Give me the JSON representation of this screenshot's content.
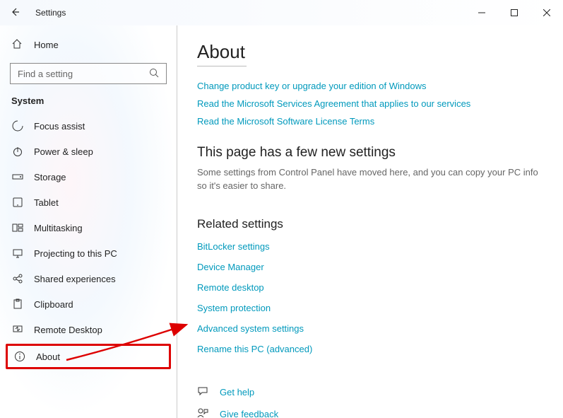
{
  "window": {
    "title": "Settings"
  },
  "sidebar": {
    "home_label": "Home",
    "search_placeholder": "Find a setting",
    "section_label": "System",
    "items": [
      {
        "label": "Focus assist",
        "icon": "focus-icon"
      },
      {
        "label": "Power & sleep",
        "icon": "power-icon"
      },
      {
        "label": "Storage",
        "icon": "storage-icon"
      },
      {
        "label": "Tablet",
        "icon": "tablet-icon"
      },
      {
        "label": "Multitasking",
        "icon": "multitasking-icon"
      },
      {
        "label": "Projecting to this PC",
        "icon": "projecting-icon"
      },
      {
        "label": "Shared experiences",
        "icon": "shared-icon"
      },
      {
        "label": "Clipboard",
        "icon": "clipboard-icon"
      },
      {
        "label": "Remote Desktop",
        "icon": "remote-icon"
      },
      {
        "label": "About",
        "icon": "about-icon",
        "selected": true
      }
    ]
  },
  "content": {
    "title": "About",
    "top_links": [
      "Change product key or upgrade your edition of Windows",
      "Read the Microsoft Services Agreement that applies to our services",
      "Read the Microsoft Software License Terms"
    ],
    "new_heading": "This page has a few new settings",
    "new_body": "Some settings from Control Panel have moved here, and you can copy your PC info so it's easier to share.",
    "related_heading": "Related settings",
    "related_links": [
      "BitLocker settings",
      "Device Manager",
      "Remote desktop",
      "System protection",
      "Advanced system settings",
      "Rename this PC (advanced)"
    ],
    "help_label": "Get help",
    "feedback_label": "Give feedback"
  }
}
